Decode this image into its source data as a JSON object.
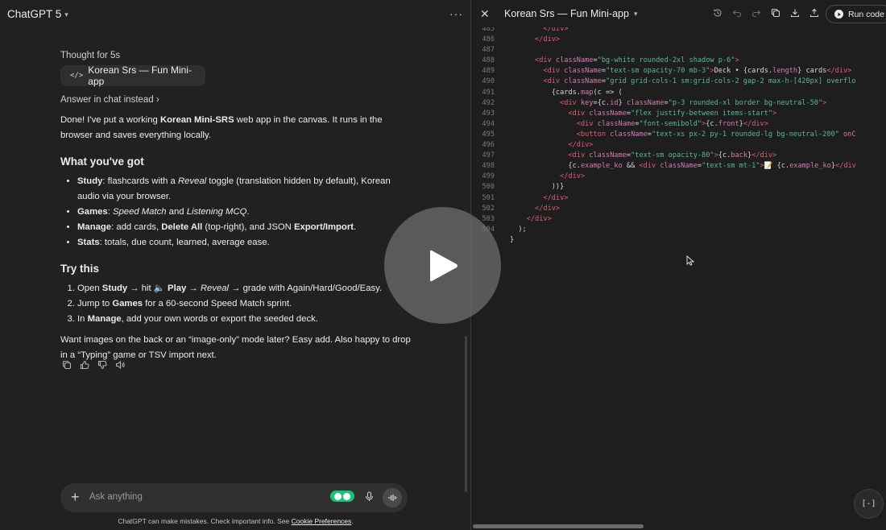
{
  "chat": {
    "model_label": "ChatGPT 5",
    "thought_label": "Thought for 5s",
    "canvas_chip_label": "Korean Srs — Fun Mini-app",
    "answer_link": "Answer in chat instead",
    "intro": {
      "a": "Done! I've put a working ",
      "b": "Korean Mini-SRS",
      "c": " web app in the canvas. It runs in the browser and saves everything locally."
    },
    "section1_title": "What you've got",
    "features": [
      {
        "b": "Study",
        "t1": ": flashcards with a ",
        "i": "Reveal",
        "t2": " toggle (translation hidden by default), Korean audio via your browser."
      },
      {
        "b": "Games",
        "t1": ": ",
        "i": "Speed Match",
        "t2": " and ",
        "i2": "Listening MCQ",
        "t3": "."
      },
      {
        "b": "Manage",
        "t1": ": add cards, ",
        "b2": "Delete All",
        "t2": " (top-right), and JSON ",
        "b3": "Export/Import",
        "t3": "."
      },
      {
        "b": "Stats",
        "t1": ": totals, due count, learned, average ease."
      }
    ],
    "section2_title": "Try this",
    "steps": [
      {
        "t1": "Open ",
        "b": "Study",
        "t2": " → hit 🔈 ",
        "b2": "Play",
        "t3": " → ",
        "i": "Reveal",
        "t4": " → grade with Again/Hard/Good/Easy."
      },
      {
        "t1": "Jump to ",
        "b": "Games",
        "t2": " for a 60-second Speed Match sprint."
      },
      {
        "t1": "In ",
        "b": "Manage",
        "t2": ", add your own words or export the seeded deck."
      }
    ],
    "outro": "Want images on the back or an “image-only” mode later? Easy add. Also happy to drop in a “Typing” game or TSV import next.",
    "composer_placeholder": "Ask anything",
    "disclaimer": "ChatGPT can make mistakes. Check important info. See ",
    "disclaimer_link": "Cookie Preferences",
    "disclaimer_end": "."
  },
  "canvas": {
    "title": "Korean Srs — Fun Mini-app",
    "run_label": "Run code",
    "fab_label": "[-]",
    "code_lines": [
      {
        "n": "485",
        "html": "        <span class='t'>&lt;/div&gt;</span>"
      },
      {
        "n": "486",
        "html": "      <span class='t'>&lt;/div&gt;</span>"
      },
      {
        "n": "487",
        "html": ""
      },
      {
        "n": "488",
        "html": "      <span class='t'>&lt;div</span> <span class='a'>className</span>=<span class='s'>\"bg-white rounded-2xl shadow p-6\"</span><span class='t'>&gt;</span>"
      },
      {
        "n": "489",
        "html": "        <span class='t'>&lt;div</span> <span class='a'>className</span>=<span class='s'>\"text-sm opacity-70 mb-3\"</span><span class='t'>&gt;</span>Deck • {cards.<span class='a'>length</span>} cards<span class='t'>&lt;/div&gt;</span>"
      },
      {
        "n": "490",
        "html": "        <span class='t'>&lt;div</span> <span class='a'>className</span>=<span class='s'>\"grid grid-cols-1 sm:grid-cols-2 gap-2 max-h-[420px] overflo</span>"
      },
      {
        "n": "491",
        "html": "          {cards.<span class='a'>map</span>(c =&gt; ("
      },
      {
        "n": "492",
        "html": "            <span class='t'>&lt;div</span> <span class='a'>key</span>={c.<span class='a'>id</span>} <span class='a'>className</span>=<span class='s'>\"p-3 rounded-xl border bg-neutral-50\"</span><span class='t'>&gt;</span>"
      },
      {
        "n": "493",
        "html": "              <span class='t'>&lt;div</span> <span class='a'>className</span>=<span class='s'>\"flex justify-between items-start\"</span><span class='t'>&gt;</span>"
      },
      {
        "n": "494",
        "html": "                <span class='t'>&lt;div</span> <span class='a'>className</span>=<span class='s'>\"font-semibold\"</span><span class='t'>&gt;</span>{c.<span class='a'>front</span>}<span class='t'>&lt;/div&gt;</span>"
      },
      {
        "n": "495",
        "html": "                <span class='t'>&lt;button</span> <span class='a'>className</span>=<span class='s'>\"text-xs px-2 py-1 rounded-lg bg-neutral-200\"</span> <span class='a'>onC</span>"
      },
      {
        "n": "496",
        "html": "              <span class='t'>&lt;/div&gt;</span>"
      },
      {
        "n": "497",
        "html": "              <span class='t'>&lt;div</span> <span class='a'>className</span>=<span class='s'>\"text-sm opacity-80\"</span><span class='t'>&gt;</span>{c.<span class='a'>back</span>}<span class='t'>&lt;/div&gt;</span>"
      },
      {
        "n": "498",
        "html": "              {c.<span class='a'>example_ko</span> &amp;&amp; <span class='t'>&lt;div</span> <span class='a'>className</span>=<span class='s'>\"text-sm mt-1\"</span><span class='t'>&gt;</span>📝 {c.<span class='a'>example_ko</span>}<span class='t'>&lt;/div</span>"
      },
      {
        "n": "499",
        "html": "            <span class='t'>&lt;/div&gt;</span>"
      },
      {
        "n": "500",
        "html": "          ))}"
      },
      {
        "n": "501",
        "html": "        <span class='t'>&lt;/div&gt;</span>"
      },
      {
        "n": "502",
        "html": "      <span class='t'>&lt;/div&gt;</span>"
      },
      {
        "n": "503",
        "html": "    <span class='t'>&lt;/div&gt;</span>"
      },
      {
        "n": "504",
        "html": "  );"
      },
      {
        "n": "",
        "html": "}"
      }
    ]
  }
}
